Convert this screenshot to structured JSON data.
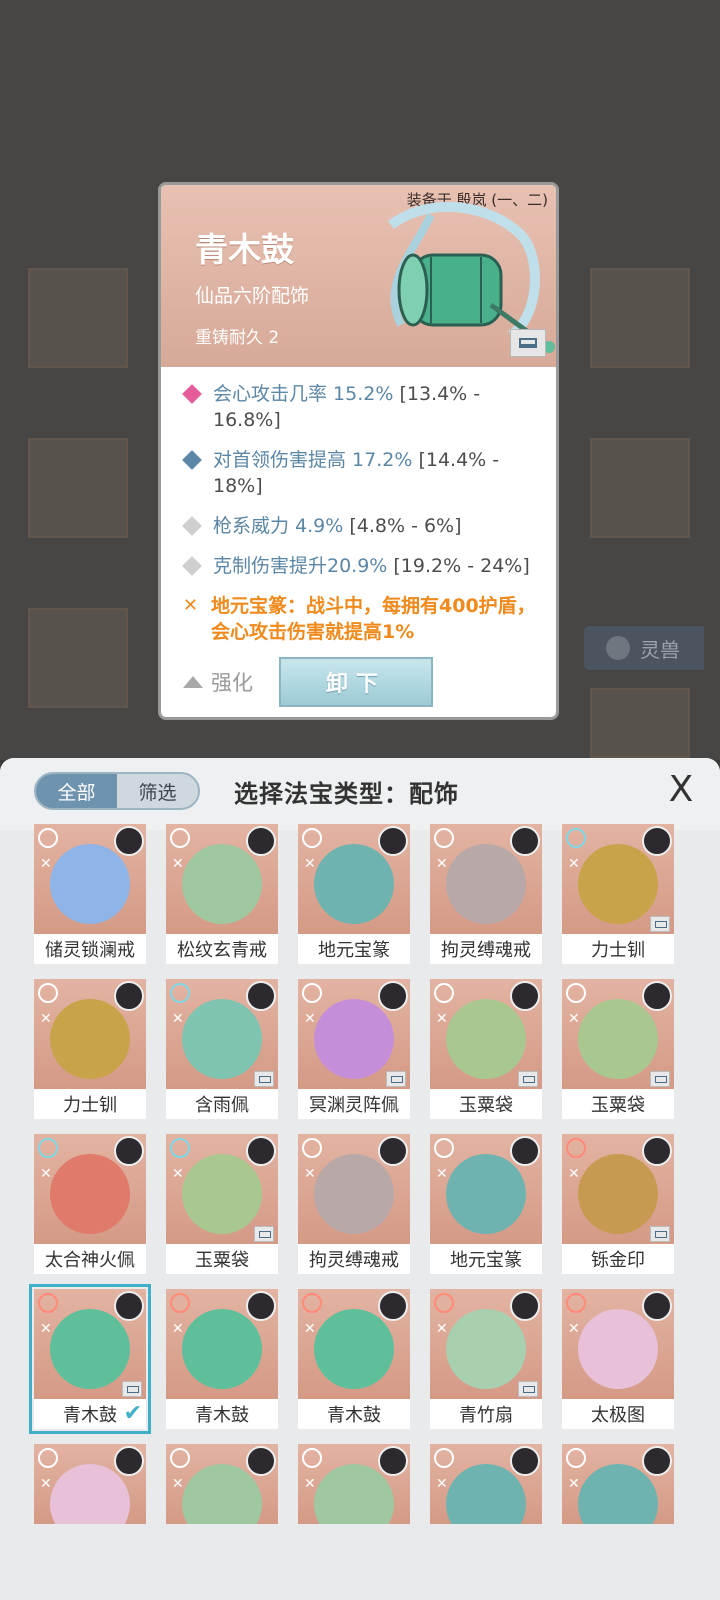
{
  "detail": {
    "equipped_on": "装备于 殷岚 (一、二)",
    "name": "青木鼓",
    "grade": "仙品六阶配饰",
    "durability": "重铸耐久 2",
    "stats": [
      {
        "color": "#e55c9b",
        "name_val": "会心攻击几率 15.2%",
        "range": " [13.4% - 16.8%]"
      },
      {
        "color": "#5b86a6",
        "name_val": "对首领伤害提高 17.2%",
        "range": " [14.4% - 18%]"
      },
      {
        "color": "#cfcfcf",
        "name_val": "枪系威力 4.9%",
        "range": " [4.8% - 6%]"
      },
      {
        "color": "#cfcfcf",
        "name_val": "克制伤害提升20.9%",
        "range": " [19.2% - 24%]"
      }
    ],
    "special": "地元宝篆：战斗中，每拥有400护盾，会心攻击伤害就提高1%",
    "enhance_label": "强化",
    "unload_label": "卸下"
  },
  "background": {
    "tab_label": "灵兽"
  },
  "panel": {
    "filter_all": "全部",
    "filter_select": "筛选",
    "type_title": "选择法宝类型：配饰",
    "close_label": "X"
  },
  "items": [
    {
      "label": "储灵锁澜戒",
      "icon_color": "#ffffff",
      "art": "#8fb4e8"
    },
    {
      "label": "松纹玄青戒",
      "icon_color": "#ffffff",
      "art": "#9fc7a0"
    },
    {
      "label": "地元宝篆",
      "icon_color": "#ffffff",
      "art": "#6fb3b0"
    },
    {
      "label": "拘灵缚魂戒",
      "icon_color": "#ffffff",
      "art": "#b8a8a8"
    },
    {
      "label": "力士钏",
      "icon_color": "#7fd8e6",
      "art": "#c8a34a"
    },
    {
      "label": "力士钏",
      "icon_color": "#ffffff",
      "art": "#c8a34a"
    },
    {
      "label": "含雨佩",
      "icon_color": "#7fd8e6",
      "art": "#7fc4b0"
    },
    {
      "label": "冥渊灵阵佩",
      "icon_color": "#ffffff",
      "art": "#c58ed8"
    },
    {
      "label": "玉粟袋",
      "icon_color": "#ffffff",
      "art": "#a8c890"
    },
    {
      "label": "玉粟袋",
      "icon_color": "#ffffff",
      "art": "#a8c890"
    },
    {
      "label": "太合神火佩",
      "icon_color": "#7fd8e6",
      "art": "#e07a6a"
    },
    {
      "label": "玉粟袋",
      "icon_color": "#7fd8e6",
      "art": "#a8c890"
    },
    {
      "label": "拘灵缚魂戒",
      "icon_color": "#ffffff",
      "art": "#b8a8a8"
    },
    {
      "label": "地元宝篆",
      "icon_color": "#ffffff",
      "art": "#6fb3b0"
    },
    {
      "label": "铄金印",
      "icon_color": "#ff8a7a",
      "art": "#c79a52"
    },
    {
      "label": "青木鼓",
      "icon_color": "#ff8a7a",
      "art": "#5fbf9a"
    },
    {
      "label": "青木鼓",
      "icon_color": "#ff8a7a",
      "art": "#5fbf9a"
    },
    {
      "label": "青木鼓",
      "icon_color": "#ff8a7a",
      "art": "#5fbf9a"
    },
    {
      "label": "青竹扇",
      "icon_color": "#ff8a7a",
      "art": "#a8d0b0"
    },
    {
      "label": "太极图",
      "icon_color": "#ff8a7a",
      "art": "#e8c0d8"
    },
    {
      "label": "",
      "icon_color": "#ffffff",
      "art": "#e8c0d8"
    },
    {
      "label": "",
      "icon_color": "#ffffff",
      "art": "#9fc7a0"
    },
    {
      "label": "",
      "icon_color": "#ffffff",
      "art": "#9fc7a0"
    },
    {
      "label": "",
      "icon_color": "#ffffff",
      "art": "#6fb3b0"
    },
    {
      "label": "",
      "icon_color": "#ffffff",
      "art": "#6fb3b0"
    }
  ]
}
